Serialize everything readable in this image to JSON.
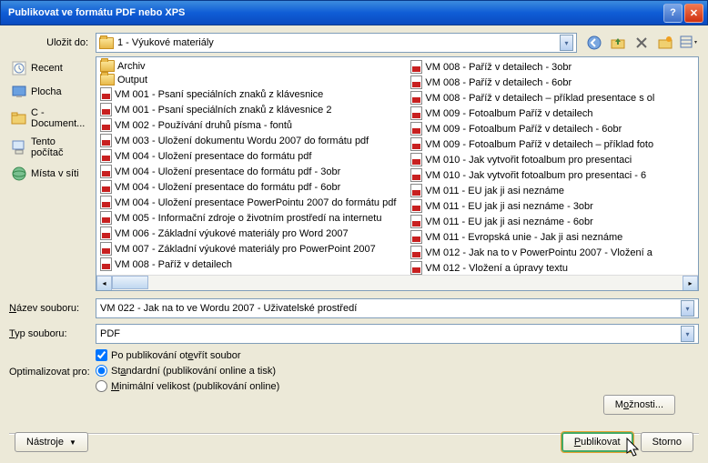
{
  "title": "Publikovat ve formátu PDF nebo XPS",
  "saveIn": {
    "label": "Uložit do:",
    "value": "1 - Výukové materiály"
  },
  "sidebar": [
    {
      "label": "Recent",
      "icon": "recent"
    },
    {
      "label": "Plocha",
      "icon": "desktop"
    },
    {
      "label": "C - Document...",
      "icon": "folder"
    },
    {
      "label": "Tento počítač",
      "icon": "computer"
    },
    {
      "label": "Místa v síti",
      "icon": "network"
    }
  ],
  "files": {
    "col1": [
      {
        "type": "folder",
        "name": "Archiv"
      },
      {
        "type": "folder",
        "name": "Output"
      },
      {
        "type": "pdf",
        "name": "VM 001 - Psaní speciálních znaků z klávesnice"
      },
      {
        "type": "pdf",
        "name": "VM 001 - Psaní speciálních znaků z klávesnice 2"
      },
      {
        "type": "pdf",
        "name": "VM 002 - Používání druhů písma - fontů"
      },
      {
        "type": "pdf",
        "name": "VM 003 - Uložení dokumentu Wordu 2007 do formátu pdf"
      },
      {
        "type": "pdf",
        "name": "VM 004 - Uložení presentace do formátu pdf"
      },
      {
        "type": "pdf",
        "name": "VM 004 - Uložení presentace do formátu pdf - 3obr"
      },
      {
        "type": "pdf",
        "name": "VM 004 - Uložení presentace do formátu pdf - 6obr"
      },
      {
        "type": "pdf",
        "name": "VM 004 - Uložení presentace PowerPointu 2007 do formátu pdf"
      },
      {
        "type": "pdf",
        "name": "VM 005 - Informační zdroje o životním prostředí na internetu"
      },
      {
        "type": "pdf",
        "name": "VM 006 - Základní výukové materiály pro Word 2007"
      },
      {
        "type": "pdf",
        "name": "VM 007 - Základní výukové materiály pro PowerPoint 2007"
      },
      {
        "type": "pdf",
        "name": "VM 008 - Paříž v detailech"
      }
    ],
    "col2": [
      {
        "type": "pdf",
        "name": "VM 008 - Paříž v detailech - 3obr"
      },
      {
        "type": "pdf",
        "name": "VM 008 - Paříž v detailech - 6obr"
      },
      {
        "type": "pdf",
        "name": "VM 008 - Paříž v detailech – příklad presentace s ol"
      },
      {
        "type": "pdf",
        "name": "VM 009 - Fotoalbum Paříž v detailech"
      },
      {
        "type": "pdf",
        "name": "VM 009 - Fotoalbum Paříž v detailech - 6obr"
      },
      {
        "type": "pdf",
        "name": "VM 009 - Fotoalbum Paříž v detailech – příklad foto"
      },
      {
        "type": "pdf",
        "name": "VM 010 - Jak vytvořit fotoalbum pro presentaci"
      },
      {
        "type": "pdf",
        "name": "VM 010 - Jak vytvořit fotoalbum pro presentaci - 6"
      },
      {
        "type": "pdf",
        "name": "VM 011 - EU jak ji asi neznáme"
      },
      {
        "type": "pdf",
        "name": "VM 011 - EU jak ji asi neznáme - 3obr"
      },
      {
        "type": "pdf",
        "name": "VM 011 - EU jak ji asi neznáme - 6obr"
      },
      {
        "type": "pdf",
        "name": "VM 011 - Evropská unie - Jak ji asi neznáme"
      },
      {
        "type": "pdf",
        "name": "VM 012 - Jak na to v PowerPointu 2007 -  Vložení a"
      },
      {
        "type": "pdf",
        "name": "VM 012 - Vložení a úpravy textu"
      }
    ]
  },
  "filename": {
    "label": "Název souboru:",
    "value": "VM 022 - Jak na to ve Wordu 2007 - Uživatelské prostředí"
  },
  "filetype": {
    "label": "Typ souboru:",
    "value": "PDF"
  },
  "openAfter": "Po publikování otevřít soubor",
  "optimize": {
    "label": "Optimalizovat pro:",
    "standard": "Standardní (publikování online a tisk)",
    "minimal": "Minimální velikost (publikování online)"
  },
  "buttons": {
    "options": "Možnosti...",
    "tools": "Nástroje",
    "publish": "Publikovat",
    "cancel": "Storno"
  }
}
